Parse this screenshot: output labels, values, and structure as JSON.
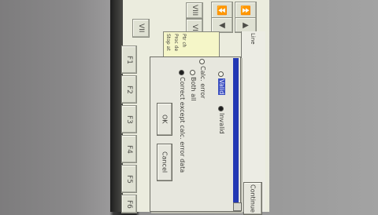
{
  "toolbar": {
    "roman_keys": [
      "VII",
      "VI",
      "VIII"
    ],
    "nav_buttons": [
      {
        "icon": "fast-forward-icon",
        "glyph": "⏩"
      },
      {
        "icon": "fast-rewind-icon",
        "glyph": "⏪"
      },
      {
        "icon": "step-forward-icon",
        "glyph": "▶"
      },
      {
        "icon": "step-back-icon",
        "glyph": "◀"
      }
    ]
  },
  "function_keys": [
    "F1",
    "F2",
    "F3",
    "F4",
    "F5",
    "F6"
  ],
  "panel": {
    "lines": [
      "Stop at",
      "Proc de",
      "Ptr ch"
    ]
  },
  "right_panel": {
    "title": "Line",
    "button": "Continue"
  },
  "dialog": {
    "options": [
      {
        "label": "Valid",
        "selected": false,
        "highlight": true
      },
      {
        "label": "Invalid",
        "selected": true,
        "highlight": false
      },
      {
        "label": "Calc. error",
        "selected": false,
        "highlight": false
      },
      {
        "label": "Both all",
        "selected": false,
        "highlight": false
      },
      {
        "label": "Correct except calc. error data",
        "selected": true,
        "highlight": false
      }
    ],
    "ok_label": "OK",
    "cancel_label": "Cancel"
  },
  "colors": {
    "accent": "#2338b4",
    "screen": "#ebecde",
    "panel_bg": "#f5f6c8"
  }
}
